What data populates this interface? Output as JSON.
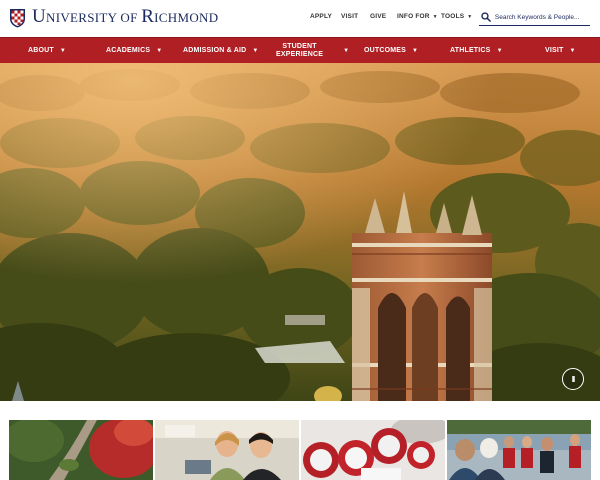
{
  "brand": {
    "name_first_letter": "U",
    "name_part1": "NIVERSITY OF ",
    "name_second_letter": "R",
    "name_part2": "ICHMOND",
    "primary_color": "#1b2a5e",
    "accent_color": "#b01f24"
  },
  "utility_nav": {
    "items": [
      {
        "label": "APPLY",
        "has_caret": false
      },
      {
        "label": "VISIT",
        "has_caret": false
      },
      {
        "label": "GIVE",
        "has_caret": false
      },
      {
        "label": "INFO FOR",
        "has_caret": true,
        "caret_icon": "chevron-down-icon"
      },
      {
        "label": "TOOLS",
        "has_caret": true,
        "caret_icon": "chevron-down-icon"
      }
    ]
  },
  "search": {
    "placeholder": "Search Keywords & People...",
    "icon": "search-icon"
  },
  "main_nav": {
    "items": [
      {
        "label": "ABOUT"
      },
      {
        "label": "ACADEMICS"
      },
      {
        "label": "ADMISSION & AID"
      },
      {
        "label_line1": "STUDENT",
        "label_line2": "EXPERIENCE"
      },
      {
        "label": "OUTCOMES"
      },
      {
        "label": "ATHLETICS"
      },
      {
        "label": "VISIT"
      }
    ],
    "caret_icon": "chevron-down-icon"
  },
  "hero": {
    "pause_icon": "pause-icon",
    "pause_glyph": "II"
  },
  "tiles": [
    {
      "icon": "campus-aerial-photo"
    },
    {
      "icon": "students-lab-photo"
    },
    {
      "icon": "lacrosse-photo"
    },
    {
      "icon": "students-outdoor-photo"
    }
  ]
}
